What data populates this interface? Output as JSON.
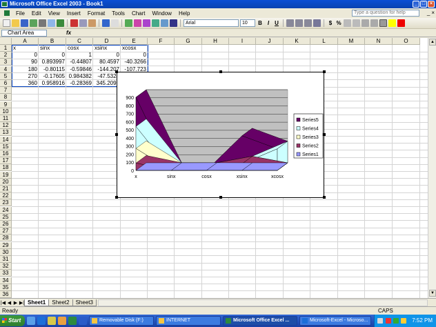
{
  "window": {
    "title": "Microsoft Office Excel 2003 - Book1",
    "min": "_",
    "max": "□",
    "close": "×"
  },
  "menu": [
    "File",
    "Edit",
    "View",
    "Insert",
    "Format",
    "Tools",
    "Chart",
    "Window",
    "Help"
  ],
  "help_placeholder": "Type a question for help",
  "toolbar": {
    "font": "Arial",
    "size": "10",
    "bold": "B",
    "italic": "I",
    "underline": "U",
    "currency": "$",
    "percent": "%"
  },
  "formula": {
    "name_box": "Chart Area",
    "fx": "fx"
  },
  "columns": [
    "A",
    "B",
    "C",
    "D",
    "E",
    "F",
    "G",
    "H",
    "I",
    "J",
    "K",
    "L",
    "M",
    "N",
    "O"
  ],
  "rows": [
    "1",
    "2",
    "3",
    "4",
    "5",
    "6",
    "7",
    "8",
    "9",
    "10",
    "11",
    "12",
    "13",
    "14",
    "15",
    "16",
    "17",
    "18",
    "19",
    "20",
    "21",
    "22",
    "23",
    "24",
    "25",
    "26",
    "27",
    "28",
    "29",
    "30",
    "31",
    "32",
    "33",
    "34",
    "35",
    "36"
  ],
  "cells": [
    [
      "x",
      "sinx",
      "cosx",
      "xsinx",
      "xcosx"
    ],
    [
      "0",
      "0",
      "1",
      "0",
      "0"
    ],
    [
      "90",
      "0.893997",
      "-0.44807",
      "80.4597",
      "-40.3266"
    ],
    [
      "180",
      "-0.80115",
      "-0.59846",
      "-144.207",
      "-107.723"
    ],
    [
      "270",
      "-0.17605",
      "0.984382",
      "-47.5324",
      "265.7831"
    ],
    [
      "360",
      "0.958916",
      "-0.28369",
      "345.2097",
      "-102.129"
    ]
  ],
  "sheets": [
    "Sheet1",
    "Sheet2",
    "Sheet3"
  ],
  "status": {
    "ready": "Ready",
    "caps": "CAPS"
  },
  "taskbar": {
    "start": "Start",
    "tasks": [
      "Removable Disk (F:)",
      "INTERNET",
      "Microsoft Office Excel ...",
      "Microsoft-Excel - Microso..."
    ],
    "clock": "7:52 PM"
  },
  "chart_data": {
    "type": "area",
    "categories": [
      "x",
      "sinx",
      "cosx",
      "xsinx",
      "xcosx"
    ],
    "ylim": [
      0,
      900
    ],
    "yticks": [
      "0",
      "100",
      "200",
      "300",
      "400",
      "500",
      "600",
      "700",
      "800",
      "900"
    ],
    "series": [
      {
        "name": "Series1",
        "values": [
          0,
          0,
          1,
          0,
          0
        ],
        "color": "#9999ff"
      },
      {
        "name": "Series2",
        "values": [
          90,
          0.893997,
          -0.44807,
          80.4597,
          -40.3266
        ],
        "color": "#993366"
      },
      {
        "name": "Series3",
        "values": [
          180,
          -0.80115,
          -0.59846,
          -144.207,
          -107.723
        ],
        "color": "#ffffcc"
      },
      {
        "name": "Series4",
        "values": [
          270,
          -0.17605,
          0.984382,
          -47.5324,
          265.7831
        ],
        "color": "#ccffff"
      },
      {
        "name": "Series5",
        "values": [
          360,
          0.958916,
          -0.28369,
          345.2097,
          -102.129
        ],
        "color": "#660066"
      }
    ],
    "legend": "right",
    "wall_color": "#c0c0c0",
    "grid": true
  }
}
